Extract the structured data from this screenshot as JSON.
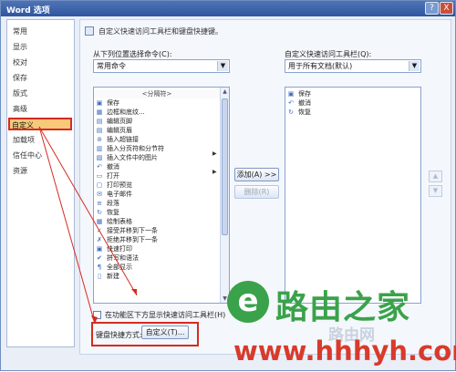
{
  "window": {
    "title": "Word 选项",
    "help": "?",
    "close": "X"
  },
  "sidebar": {
    "items": [
      "常用",
      "显示",
      "校对",
      "保存",
      "版式",
      "高级",
      "自定义",
      "加载项",
      "信任中心",
      "资源"
    ],
    "selected_index": 6
  },
  "content": {
    "intro": "自定义快速访问工具栏和键盘快捷键。",
    "choose_label": "从下列位置选择命令(C):",
    "choose_value": "常用命令",
    "customize_label": "自定义快速访问工具栏(Q):",
    "customize_value": "用于所有文档(默认)",
    "commands": [
      {
        "icon": "",
        "label": "<分隔符>"
      },
      {
        "icon": "save-icon",
        "label": "保存"
      },
      {
        "icon": "border-icon",
        "label": "边框和底纹..."
      },
      {
        "icon": "header-icon",
        "label": "编辑页脚"
      },
      {
        "icon": "header-icon",
        "label": "编辑页眉"
      },
      {
        "icon": "link-icon",
        "label": "插入超链接"
      },
      {
        "icon": "break-icon",
        "label": "插入分页符和分节符"
      },
      {
        "icon": "picture-icon",
        "label": "插入文件中的图片"
      },
      {
        "icon": "undo-icon",
        "label": "撤消"
      },
      {
        "icon": "folder-icon",
        "label": "打开"
      },
      {
        "icon": "print-preview-icon",
        "label": "打印预览"
      },
      {
        "icon": "mail-icon",
        "label": "电子邮件"
      },
      {
        "icon": "paragraph-icon",
        "label": "段落"
      },
      {
        "icon": "redo-icon",
        "label": "恢复"
      },
      {
        "icon": "table-icon",
        "label": "绘制表格"
      },
      {
        "icon": "accept-icon",
        "label": "接受并移到下一条"
      },
      {
        "icon": "reject-icon",
        "label": "拒绝并移到下一条"
      },
      {
        "icon": "print-icon",
        "label": "快速打印"
      },
      {
        "icon": "spelling-icon",
        "label": "拼写和语法"
      },
      {
        "icon": "all-pages-icon",
        "label": "全部显示"
      },
      {
        "icon": "new-icon",
        "label": "新建"
      }
    ],
    "qat_items": [
      {
        "icon": "save-icon",
        "label": "保存"
      },
      {
        "icon": "undo-icon",
        "label": "撤消"
      },
      {
        "icon": "redo-icon",
        "label": "恢复"
      }
    ],
    "add_button": "添加(A) >>",
    "remove_button": "删除(R)",
    "show_below_label": "在功能区下方显示快速访问工具栏(H)",
    "shortcut_label": "键盘快捷方式:",
    "customize_button": "自定义(T)..."
  },
  "watermark": {
    "logo_char": "e",
    "name": "路由之家",
    "url": "www.hhhyh.com",
    "faint": "路由网"
  },
  "colors": {
    "highlight_border": "#d62b1f",
    "selected_fill": "#f8c97a",
    "watermark_green": "#3aa24a",
    "watermark_red": "#d93a2b"
  }
}
